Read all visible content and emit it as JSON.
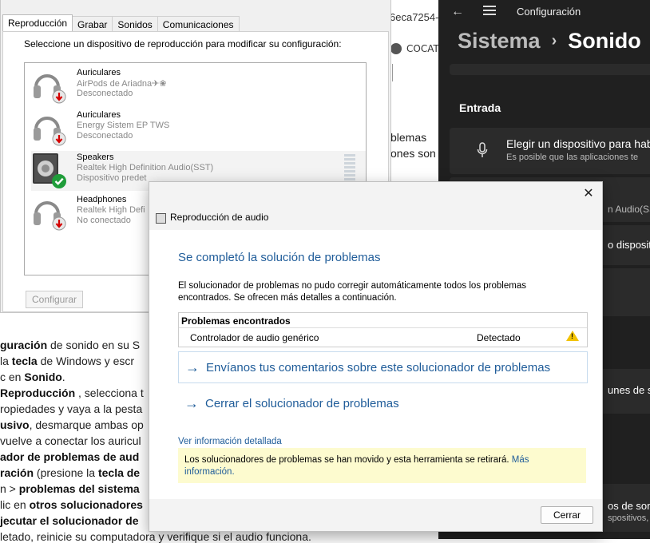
{
  "article": {
    "right_top": "6eca7254-",
    "chip_label": "COCAT",
    "right_frag1": "blemas",
    "right_frag2": "ones son",
    "left_lines": [
      {
        "bold": "guración",
        "rest": " de sonido en su S"
      },
      {
        "pre": "la ",
        "bold": "tecla",
        "rest": " de Windows y escr"
      },
      {
        "pre": "c en ",
        "bold": "Sonido",
        "rest": "."
      },
      {
        "bold": "Reproducción",
        "rest": " , selecciona t"
      },
      {
        "pre": "ropiedades y vaya a la pesta",
        "bold": "",
        "rest": ""
      },
      {
        "bold": "usivo",
        "rest": ", desmarque ambas op"
      },
      {
        "pre": "vuelve a conectar los auricul",
        "bold": "",
        "rest": ""
      },
      {
        "bold": "ador de problemas de aud",
        "rest": ""
      },
      {
        "bold": "ración",
        "rest": " (presione la ",
        "bold2": "tecla de"
      },
      {
        "pre": "n > ",
        "bold": "problemas del sistema",
        "rest": ""
      },
      {
        "pre": "lic en ",
        "bold": "otros solucionadores",
        "rest": ""
      },
      {
        "bold": "jecutar el solucionador de",
        "rest": ""
      },
      {
        "pre": "letado, reinicie su computadora y verifique si el audio funciona.",
        "bold": "",
        "rest": ""
      }
    ]
  },
  "settings": {
    "app_title": "Configuración",
    "breadcrumb_parent": "Sistema",
    "breadcrumb_separator": "›",
    "breadcrumb_current": "Sonido",
    "section_input": "Entrada",
    "choose_device": "Elegir un dispositivo para hab",
    "choose_device_sub": "Es posible que las aplicaciones te",
    "frag_audio": "n Audio(SST",
    "frag_device": "o dispositi",
    "frag_common": "unes de s",
    "frag_sound": "os de son",
    "frag_sound_sub": "spositivos, s"
  },
  "sound_dialog": {
    "tabs": [
      "Reproducción",
      "Grabar",
      "Sonidos",
      "Comunicaciones"
    ],
    "instruction": "Seleccione un dispositivo de reproducción para modificar su configuración:",
    "devices": [
      {
        "name": "Auriculares",
        "sub": "AirPods de Ariadna✈❀",
        "state": "Desconectado",
        "status": "disconnected"
      },
      {
        "name": "Auriculares",
        "sub": "Energy Sistem EP TWS",
        "state": "Desconectado",
        "status": "disconnected"
      },
      {
        "name": "Speakers",
        "sub": "Realtek High Definition Audio(SST)",
        "state": "Dispositivo predet",
        "status": "default"
      },
      {
        "name": "Headphones",
        "sub": "Realtek High Defi",
        "state": "No conectado",
        "status": "disconnected"
      }
    ],
    "configure_label": "Configurar"
  },
  "troubleshooter": {
    "title": "Reproducción de audio",
    "heading": "Se completó la solución de problemas",
    "description": "El solucionador de problemas no pudo corregir automáticamente todos los problemas encontrados. Se ofrecen más detalles a continuación.",
    "problems_header": "Problemas encontrados",
    "problem": "Controlador de audio genérico",
    "problem_status": "Detectado",
    "link_feedback": "Envíanos tus comentarios sobre este solucionador de problemas",
    "link_close": "Cerrar el solucionador de problemas",
    "details_link": "Ver información detallada",
    "notice": "Los solucionadores de problemas se han movido y esta herramienta se retirará.",
    "notice_more": "Más información.",
    "close_button": "Cerrar",
    "close_x": "✕"
  },
  "colors": {
    "link": "#1f5c99",
    "notice_bg": "#fdfbcf",
    "settings_bg": "#202020",
    "warning": "#f2c200"
  }
}
